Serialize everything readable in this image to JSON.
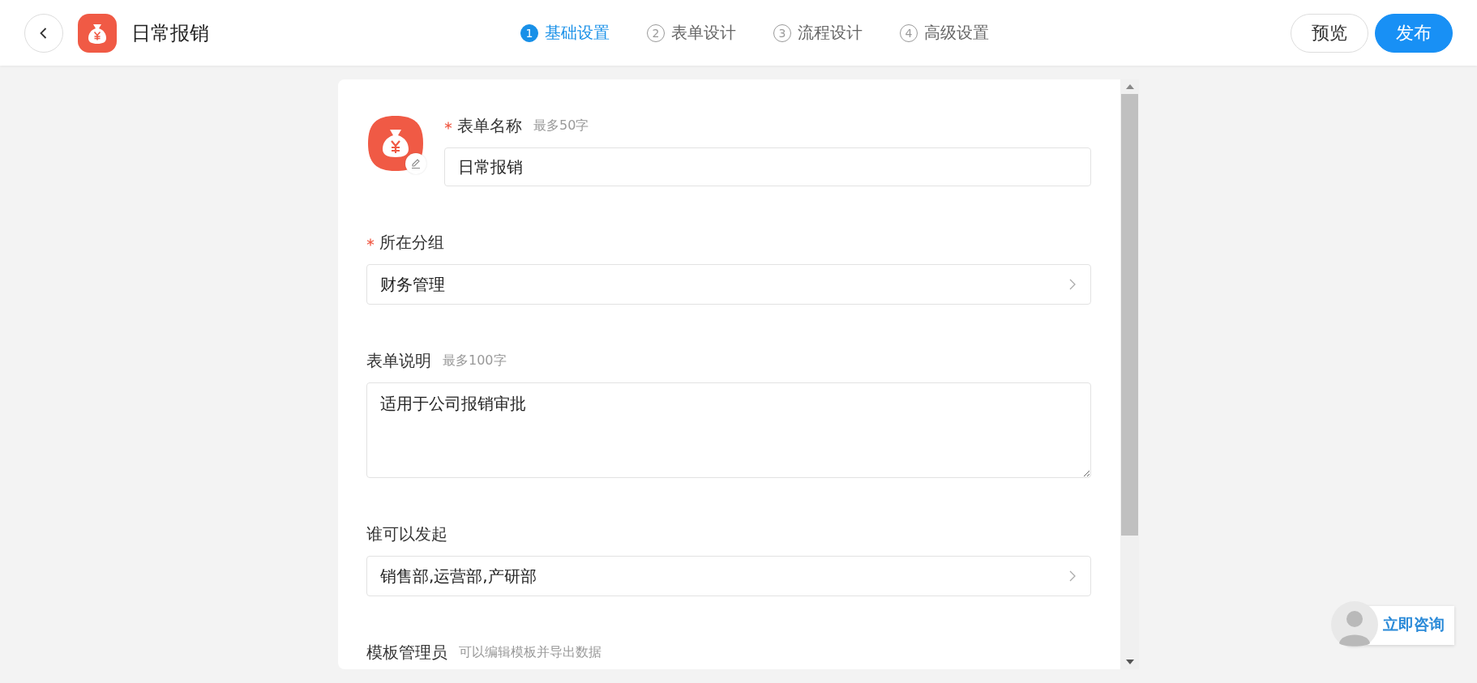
{
  "header": {
    "title": "日常报销"
  },
  "steps": [
    {
      "number": "1",
      "label": "基础设置",
      "selected": true
    },
    {
      "number": "2",
      "label": "表单设计",
      "selected": false
    },
    {
      "number": "3",
      "label": "流程设计",
      "selected": false
    },
    {
      "number": "4",
      "label": "高级设置",
      "selected": false
    }
  ],
  "actions": [
    {
      "label": "预览",
      "kind": "secondary"
    },
    {
      "label": "发布",
      "kind": "primary"
    }
  ],
  "form": {
    "fields": [
      {
        "label": "表单名称",
        "hint": "最多50字",
        "required": true,
        "kind": "input",
        "value": "日常报销"
      },
      {
        "label": "所在分组",
        "required": true,
        "kind": "select",
        "value": "财务管理"
      },
      {
        "label": "表单说明",
        "hint": "最多100字",
        "required": false,
        "kind": "textarea",
        "value": "适用于公司报销审批"
      },
      {
        "label": "谁可以发起",
        "required": false,
        "kind": "select",
        "value": "销售部,运营部,产研部"
      },
      {
        "label": "模板管理员",
        "hint": "可以编辑模板并导出数据",
        "required": false,
        "kind": "heading"
      }
    ]
  },
  "consult": {
    "label": "立即咨询"
  }
}
